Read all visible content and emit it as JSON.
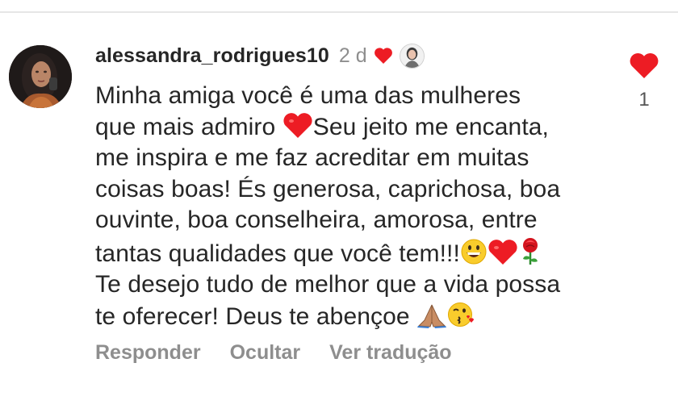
{
  "comment": {
    "username": "alessandra_rodrigues10",
    "time": "2 d",
    "body_lines": [
      "Minha amiga você é uma das mulheres",
      "que mais admiro ",
      "Seu  jeito me encanta,",
      "me inspira e me faz acreditar em muitas",
      "coisas boas! És generosa, caprichosa, boa",
      "ouvinte, boa conselheira, amorosa, entre",
      "tantas qualidades que você tem!!!",
      "Te desejo tudo de melhor que a vida possa",
      "te oferecer! Deus te abençoe "
    ],
    "actions": {
      "reply": "Responder",
      "hide": "Ocultar",
      "translate": "Ver tradução"
    },
    "like_count": "1"
  },
  "colors": {
    "heart_red": "#ed1c24",
    "muted_text": "#8e8e8e",
    "primary_text": "#262626"
  },
  "icons": {
    "author_liked": "red-heart-icon",
    "like": "heart-icon",
    "emojis": [
      "red-heart-emoji",
      "grinning-face-emoji",
      "red-heart-emoji",
      "rose-emoji",
      "praying-hands-emoji",
      "face-blowing-kiss-emoji"
    ]
  }
}
